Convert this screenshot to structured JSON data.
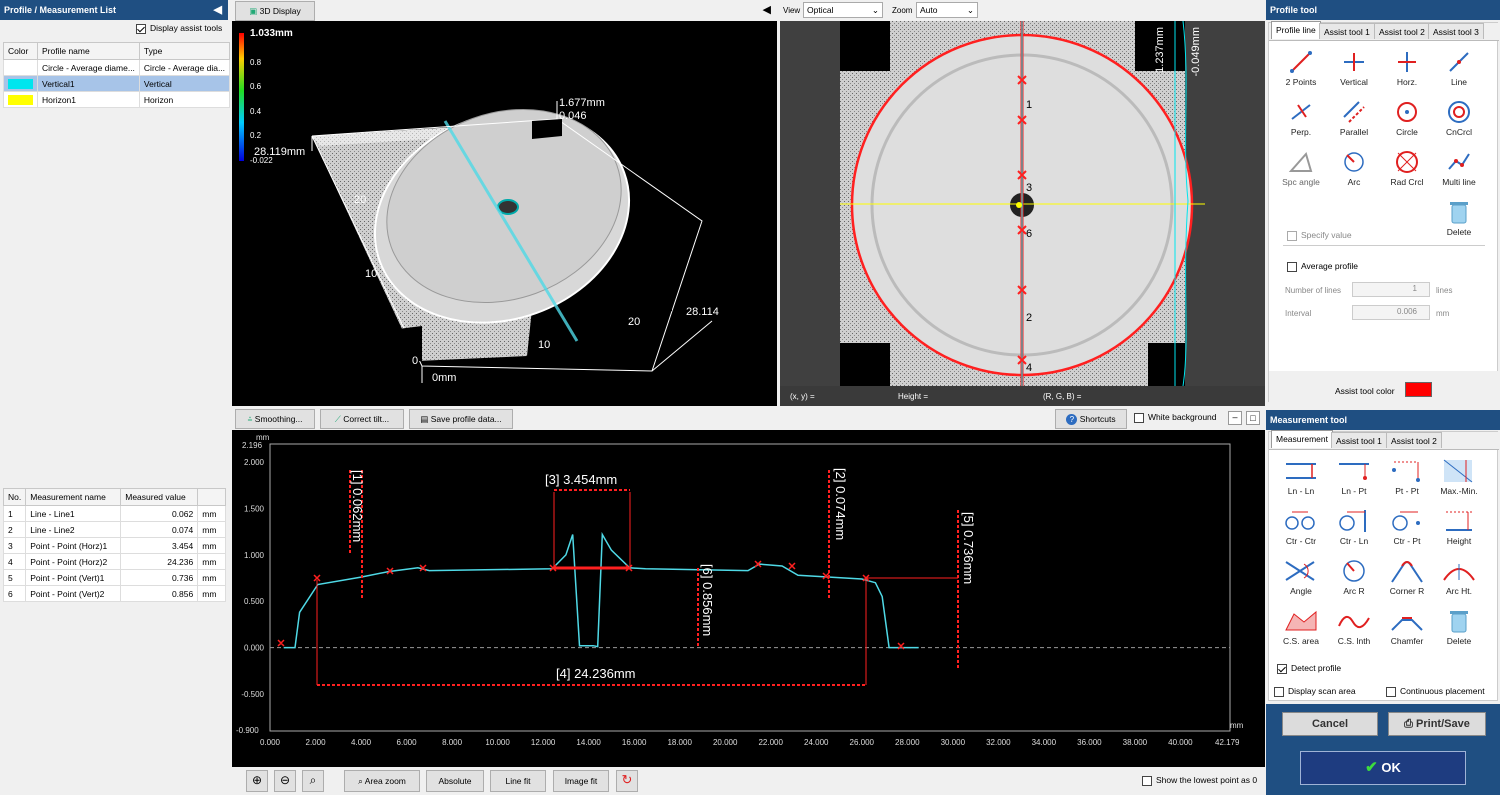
{
  "left_panel": {
    "title": "Profile / Measurement List",
    "display_assist_label": "Display assist tools",
    "profile_headers": [
      "Color",
      "Profile name",
      "Type"
    ],
    "profiles": [
      {
        "color": "#ffffff",
        "name": "Circle - Average diame...",
        "type": "Circle - Average dia..."
      },
      {
        "color": "#00e5ee",
        "name": "Vertical1",
        "type": "Vertical"
      },
      {
        "color": "#ffff00",
        "name": "Horizon1",
        "type": "Horizon"
      }
    ],
    "measure_headers": [
      "No.",
      "Measurement name",
      "Measured value",
      ""
    ],
    "measurements": [
      {
        "no": "1",
        "name": "Line - Line1",
        "value": "0.062",
        "unit": "mm"
      },
      {
        "no": "2",
        "name": "Line - Line2",
        "value": "0.074",
        "unit": "mm"
      },
      {
        "no": "3",
        "name": "Point - Point (Horz)1",
        "value": "3.454",
        "unit": "mm"
      },
      {
        "no": "4",
        "name": "Point - Point (Horz)2",
        "value": "24.236",
        "unit": "mm"
      },
      {
        "no": "5",
        "name": "Point - Point (Vert)1",
        "value": "0.736",
        "unit": "mm"
      },
      {
        "no": "6",
        "name": "Point - Point (Vert)2",
        "value": "0.856",
        "unit": "mm"
      }
    ]
  },
  "view3d": {
    "button": "3D Display",
    "scale": [
      "1.033mm",
      "0.8",
      "0.6",
      "0.4",
      "0.2",
      "-0.022"
    ],
    "labels": {
      "top_mm": "1.677mm",
      "top_val": "0.046",
      "y_mm": "28.119mm",
      "ticks_left": [
        "20",
        "10",
        "0"
      ],
      "ticks_right": [
        "20",
        "10"
      ],
      "x_end": "28.114",
      "origin": "0mm"
    }
  },
  "optical": {
    "view_label": "View",
    "view_value": "Optical",
    "zoom_label": "Zoom",
    "zoom_value": "Auto",
    "markers": [
      "1",
      "3",
      "6",
      "2",
      "4"
    ],
    "vert_labels": [
      "1.237mm",
      "-0.049mm"
    ],
    "status": {
      "xy": "(x, y)  =",
      "height": "Height  =",
      "rgb": "(R, G, B)  ="
    }
  },
  "profile_graph": {
    "toolbar": [
      "Smoothing...",
      "Correct tilt...",
      "Save profile data..."
    ],
    "shortcuts": "Shortcuts",
    "white_bg": "White background",
    "unit_y": "mm",
    "unit_x": "mm",
    "top_y": "2.196",
    "bottom_y": "-0.900",
    "end_x": "42.179",
    "annotations": {
      "a1": "[1] 0.062mm",
      "a2": "[2] 0.074mm",
      "a3": "[3] 3.454mm",
      "a4": "[4] 24.236mm",
      "a5": "[5] 0.736mm",
      "a6": "[6] 0.856mm"
    },
    "bottom_buttons": [
      "Area zoom",
      "Absolute",
      "Line fit",
      "Image fit"
    ],
    "lowest_point": "Show the lowest point as 0"
  },
  "chart_data": {
    "type": "line",
    "x_ticks": [
      "0.000",
      "2.000",
      "4.000",
      "6.000",
      "8.000",
      "10.000",
      "12.000",
      "14.000",
      "16.000",
      "18.000",
      "20.000",
      "22.000",
      "24.000",
      "26.000",
      "28.000",
      "30.000",
      "32.000",
      "34.000",
      "36.000",
      "38.000",
      "40.000"
    ],
    "y_ticks": [
      "2.000",
      "1.500",
      "1.000",
      "0.500",
      "0.000",
      "-0.500"
    ],
    "xlim": [
      0,
      42.179
    ],
    "ylim": [
      -0.9,
      2.196
    ],
    "series": [
      {
        "x": [
          0.6,
          1.1,
          1.3,
          2.1,
          4.0,
          5.2,
          6.5,
          7.0,
          12.4,
          13.0,
          13.3,
          13.6,
          14.2,
          14.4,
          14.6,
          15.0,
          15.8,
          16.5,
          21.0,
          21.5,
          22.5,
          23.2,
          26.0,
          26.6,
          26.9,
          27.2,
          28.5
        ],
        "y": [
          0.0,
          0.0,
          0.38,
          0.68,
          0.76,
          0.82,
          0.86,
          0.83,
          0.85,
          1.0,
          1.22,
          0.02,
          0.02,
          0.01,
          1.22,
          1.05,
          0.86,
          0.85,
          0.83,
          0.9,
          0.88,
          0.78,
          0.74,
          0.7,
          0.55,
          0.0,
          0.0
        ]
      }
    ]
  },
  "profile_tool": {
    "title": "Profile tool",
    "tabs": [
      "Profile line",
      "Assist tool 1",
      "Assist tool 2",
      "Assist tool 3"
    ],
    "tools": [
      "2 Points",
      "Vertical",
      "Horz.",
      "Line",
      "Perp.",
      "Parallel",
      "Circle",
      "CnCrcl",
      "Spc angle",
      "Arc",
      "Rad Crcl",
      "Multi line",
      "Delete"
    ],
    "specify_value": "Specify value",
    "average_profile": "Average profile",
    "num_lines_label": "Number of lines",
    "num_lines_value": "1",
    "num_lines_unit": "lines",
    "interval_label": "Interval",
    "interval_value": "0.006",
    "interval_unit": "mm",
    "assist_color_label": "Assist tool color",
    "assist_color": "#ff0000"
  },
  "measure_tool": {
    "title": "Measurement tool",
    "tabs": [
      "Measurement",
      "Assist tool 1",
      "Assist tool 2"
    ],
    "tools": [
      "Ln - Ln",
      "Ln - Pt",
      "Pt - Pt",
      "Max.-Min.",
      "Ctr - Ctr",
      "Ctr - Ln",
      "Ctr - Pt",
      "Height",
      "Angle",
      "Arc R",
      "Corner R",
      "Arc Ht.",
      "C.S. area",
      "C.S. lnth",
      "Chamfer",
      "Delete"
    ],
    "detect_profile": "Detect profile",
    "display_scan": "Display scan area",
    "continuous": "Continuous placement",
    "cancel": "Cancel",
    "print_save": "Print/Save",
    "ok": "OK"
  }
}
